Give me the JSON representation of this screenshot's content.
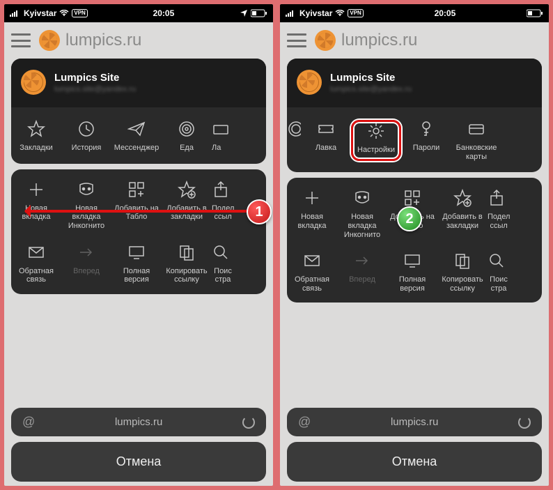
{
  "statusbar": {
    "carrier": "Kyivstar",
    "vpn": "VPN",
    "time": "20:05"
  },
  "brand": "lumpics.ru",
  "account": {
    "name": "Lumpics Site",
    "email": "lumpics.site@yandex.ru"
  },
  "left": {
    "row1": [
      {
        "label": "Закладки",
        "icon": "star"
      },
      {
        "label": "История",
        "icon": "history"
      },
      {
        "label": "Мессенджер",
        "icon": "send"
      },
      {
        "label": "Еда",
        "icon": "spiral"
      },
      {
        "label": "Ла",
        "icon": "ticket"
      }
    ]
  },
  "right": {
    "row1": [
      {
        "label": "",
        "icon": "spiral"
      },
      {
        "label": "Лавка",
        "icon": "ticket"
      },
      {
        "label": "Настройки",
        "icon": "gear"
      },
      {
        "label": "Пароли",
        "icon": "key"
      },
      {
        "label": "Банковские карты",
        "icon": "card"
      }
    ]
  },
  "grid1": [
    {
      "label": "Новая вкладка",
      "icon": "plus"
    },
    {
      "label": "Новая вкладка Инкогнито",
      "icon": "mask"
    },
    {
      "label": "Добавить на Табло",
      "icon": "tiles"
    },
    {
      "label": "Добавить в закладки",
      "icon": "star-add"
    },
    {
      "label": "Подел\nссыл",
      "icon": "share"
    }
  ],
  "grid2": [
    {
      "label": "Обратная связь",
      "icon": "mail"
    },
    {
      "label": "Вперед",
      "icon": "arrow-right",
      "disabled": true
    },
    {
      "label": "Полная версия",
      "icon": "monitor"
    },
    {
      "label": "Копировать ссылку",
      "icon": "copy"
    },
    {
      "label": "Поис\nстра",
      "icon": "search"
    }
  ],
  "url": "lumpics.ru",
  "cancel": "Отмена",
  "callouts": {
    "one": "1",
    "two": "2"
  }
}
